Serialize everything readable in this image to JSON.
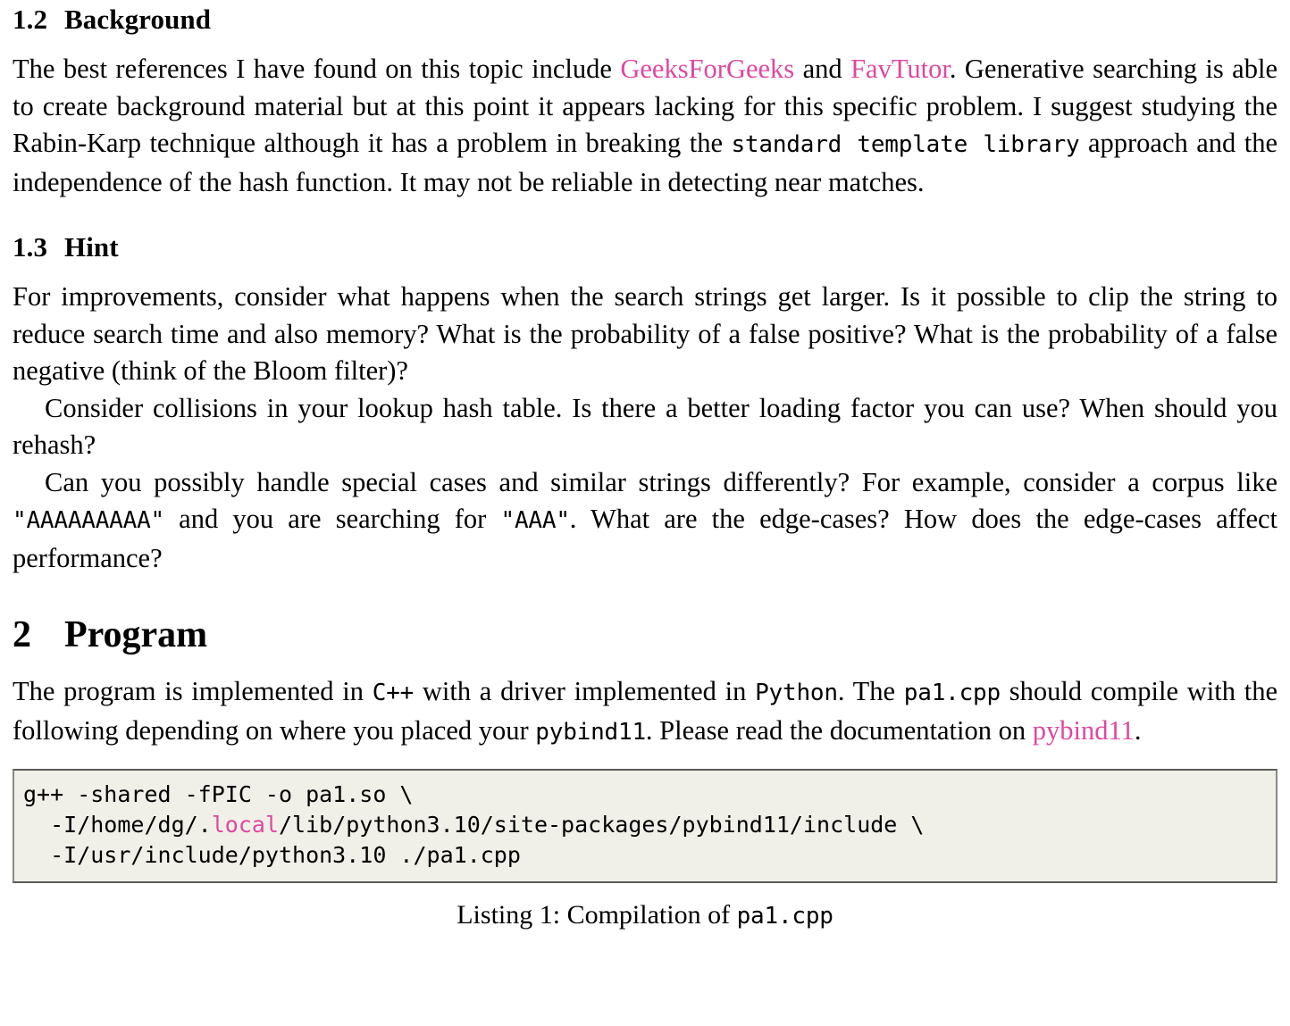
{
  "colors": {
    "link": "#E0479F",
    "code_background": "#F0F0E8",
    "code_border": "#5A5A55",
    "text": "#000000"
  },
  "sections": {
    "background": {
      "number": "1.2",
      "title": "Background",
      "paragraph": {
        "p1": "The best references I have found on this topic include ",
        "link1": "GeeksForGeeks",
        "p2": " and ",
        "link2": "FavTutor",
        "p3": ". Generative searching is able to create background material but at this point it appears lacking for this specific problem. I suggest studying the Rabin-Karp technique although it has a problem in breaking the ",
        "code1": "standard template library",
        "p4": " approach and the independence of the hash function. It may not be reliable in detecting near matches."
      }
    },
    "hint": {
      "number": "1.3",
      "title": "Hint",
      "paragraph_1": "For improvements, consider what happens when the search strings get larger. Is it possible to clip the string to reduce search time and also memory? What is the probability of a false positive? What is the probability of a false negative (think of the Bloom filter)?",
      "paragraph_2": "Consider collisions in your lookup hash table. Is there a better loading factor you can use? When should you rehash?",
      "paragraph_3": {
        "p1": "Can you possibly handle special cases and similar strings differently? For example, consider a corpus like ",
        "code1": "\"AAAAAAAAA\"",
        "p2": " and you are searching for ",
        "code2": "\"AAA\"",
        "p3": ". What are the edge-cases? How does the edge-cases affect performance?"
      }
    },
    "program": {
      "number": "2",
      "title": "Program",
      "paragraph": {
        "p1": "The program is implemented in ",
        "code1": "C++",
        "p2": " with a driver implemented in ",
        "code2": "Python",
        "p3": ". The ",
        "code3": "pa1.cpp",
        "p4": " should compile with the following depending on where you placed your ",
        "code4": "pybind11",
        "p5": ". Please read the documentation on ",
        "link1": "pybind11",
        "p6": "."
      },
      "listing": {
        "line1_a": "g++ -shared -fPIC -o pa1.so \\",
        "line2_a": "  -I/home/dg/.",
        "line2_kw": "local",
        "line2_b": "/lib/python3.10/site-packages/pybind11/include \\",
        "line3_a": "  -I/usr/include/python3.10 ./pa1.cpp"
      },
      "caption": {
        "prefix": "Listing 1: Compilation of ",
        "file": "pa1.cpp"
      }
    }
  }
}
